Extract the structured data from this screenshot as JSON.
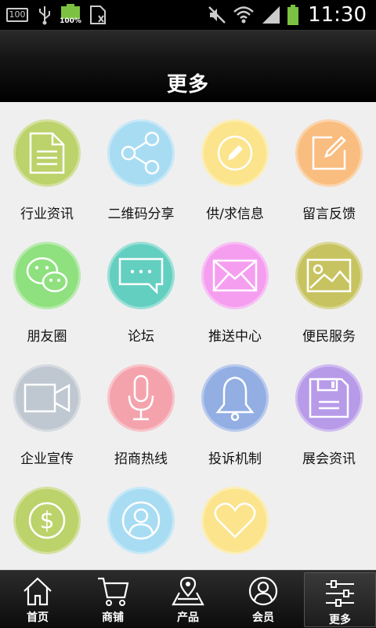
{
  "status_bar": {
    "sim_badge": "100",
    "battery_percent_label": "100%",
    "time": "11:30"
  },
  "header": {
    "title": "更多"
  },
  "grid": [
    {
      "label": "行业资讯",
      "icon": "document-icon",
      "color": "#bcd26a"
    },
    {
      "label": "二维码分享",
      "icon": "share-icon",
      "color": "#a8dcf3"
    },
    {
      "label": "供/求信息",
      "icon": "pencil-icon",
      "color": "#fbe48c"
    },
    {
      "label": "留言反馈",
      "icon": "edit-icon",
      "color": "#f9bd80"
    },
    {
      "label": "朋友圈",
      "icon": "wechat-icon",
      "color": "#8fe07f"
    },
    {
      "label": "论坛",
      "icon": "chat-bubble-icon",
      "color": "#63cfc1"
    },
    {
      "label": "推送中心",
      "icon": "mail-icon",
      "color": "#f59ef0"
    },
    {
      "label": "便民服务",
      "icon": "picture-icon",
      "color": "#c7c360"
    },
    {
      "label": "企业宣传",
      "icon": "video-camera-icon",
      "color": "#bfc7d0"
    },
    {
      "label": "招商热线",
      "icon": "microphone-icon",
      "color": "#f4a3ad"
    },
    {
      "label": "投诉机制",
      "icon": "bell-icon",
      "color": "#92aee3"
    },
    {
      "label": "展会资讯",
      "icon": "floppy-disk-icon",
      "color": "#b79ae8"
    },
    {
      "label": "",
      "icon": "dollar-coin-icon",
      "color": "#bcd26a"
    },
    {
      "label": "",
      "icon": "user-icon",
      "color": "#a8dcf3"
    },
    {
      "label": "",
      "icon": "heart-icon",
      "color": "#fbe48c"
    }
  ],
  "bottom_nav": [
    {
      "label": "首页",
      "icon": "home-icon"
    },
    {
      "label": "商铺",
      "icon": "cart-icon"
    },
    {
      "label": "产品",
      "icon": "map-pin-icon"
    },
    {
      "label": "会员",
      "icon": "member-icon"
    },
    {
      "label": "更多",
      "icon": "sliders-icon",
      "active": true
    }
  ]
}
